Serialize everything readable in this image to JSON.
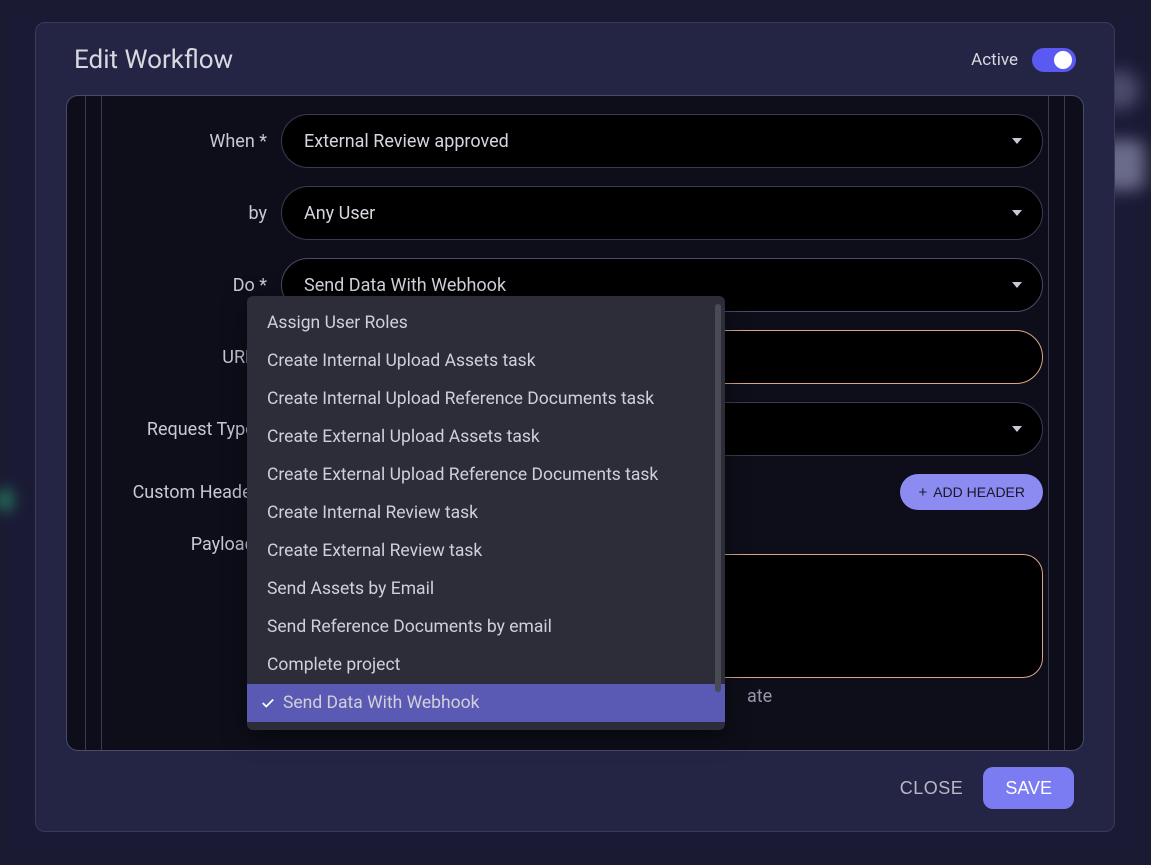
{
  "header": {
    "title": "Edit Workflow",
    "active_label": "Active",
    "active_value": true
  },
  "form": {
    "when": {
      "label": "When",
      "required": "*",
      "value": "External Review approved"
    },
    "by": {
      "label": "by",
      "value": "Any User"
    },
    "do": {
      "label": "Do",
      "required": "*",
      "value": "Send Data With Webhook"
    },
    "url": {
      "label": "URL",
      "required": "*"
    },
    "request_type": {
      "label": "Request Type",
      "required": "*"
    },
    "custom_headers": {
      "label": "Custom Headers",
      "add_button": "ADD HEADER"
    },
    "payload": {
      "label": "Payload",
      "required": "*",
      "hint_fragment": "ate"
    }
  },
  "dropdown": {
    "items": [
      "Assign User Roles",
      "Create Internal Upload Assets task",
      "Create Internal Upload Reference Documents task",
      "Create External Upload Assets task",
      "Create External Upload Reference Documents task",
      "Create Internal Review task",
      "Create External Review task",
      "Send Assets by Email",
      "Send Reference Documents by email",
      "Complete project",
      "Send Data With Webhook"
    ],
    "selected_index": 10
  },
  "footer": {
    "close": "CLOSE",
    "save": "SAVE"
  }
}
